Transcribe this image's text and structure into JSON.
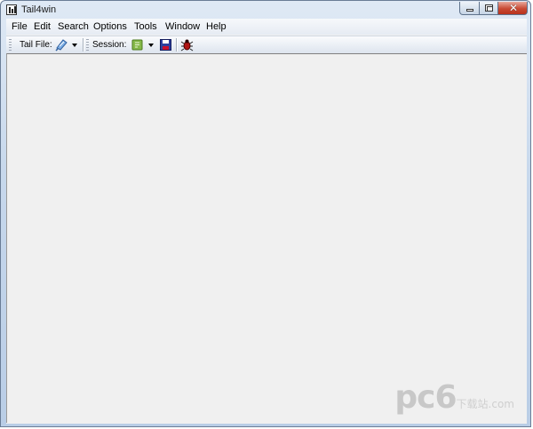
{
  "window": {
    "title": "Tail4win",
    "controls": {
      "minimize": "minimize",
      "maximize": "maximize",
      "close": "✕"
    }
  },
  "menu": [
    "File",
    "Edit",
    "Search",
    "Options",
    "Tools",
    "Window",
    "Help"
  ],
  "toolbar": {
    "tail_file_label": "Tail File:",
    "session_label": "Session:",
    "icons": [
      "open-file-icon",
      "session-open-icon",
      "save-icon",
      "bug-icon"
    ]
  },
  "watermark": {
    "main": "pc6",
    "sub": "下载站",
    "domain": ".com"
  }
}
